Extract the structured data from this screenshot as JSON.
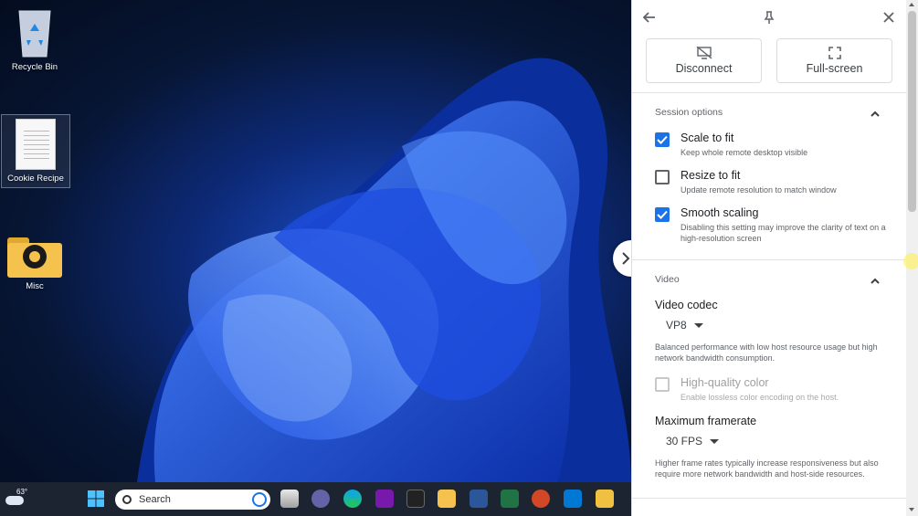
{
  "desktop": {
    "icons": [
      {
        "label": "Recycle Bin"
      },
      {
        "label": "Cookie Recipe"
      },
      {
        "label": "Misc"
      }
    ]
  },
  "taskbar": {
    "weather_temp": "63°",
    "search_placeholder": "Search",
    "apps": [
      "windows-start",
      "task-view",
      "teams",
      "edge",
      "onenote",
      "resolve",
      "file-explorer",
      "word",
      "excel",
      "powerpoint",
      "outlook",
      "other"
    ]
  },
  "panel": {
    "top_buttons": {
      "disconnect": "Disconnect",
      "fullscreen": "Full-screen"
    },
    "session": {
      "title": "Session options",
      "options": [
        {
          "label": "Scale to fit",
          "desc": "Keep whole remote desktop visible",
          "checked": true
        },
        {
          "label": "Resize to fit",
          "desc": "Update remote resolution to match window",
          "checked": false
        },
        {
          "label": "Smooth scaling",
          "desc": "Disabling this setting may improve the clarity of text on a high-resolution screen",
          "checked": true
        }
      ]
    },
    "video": {
      "title": "Video",
      "codec_label": "Video codec",
      "codec_value": "VP8",
      "codec_help": "Balanced performance with low host resource usage but high network bandwidth consumption.",
      "hq_label": "High-quality color",
      "hq_desc": "Enable lossless color encoding on the host.",
      "framerate_label": "Maximum framerate",
      "framerate_value": "30 FPS",
      "framerate_help": "Higher frame rates typically increase responsiveness but also require more network bandwidth and host-side resources."
    }
  },
  "colors": {
    "accent": "#1a73e8",
    "taskbar": "#1c2331",
    "panel_bg": "#f8f9fa"
  }
}
